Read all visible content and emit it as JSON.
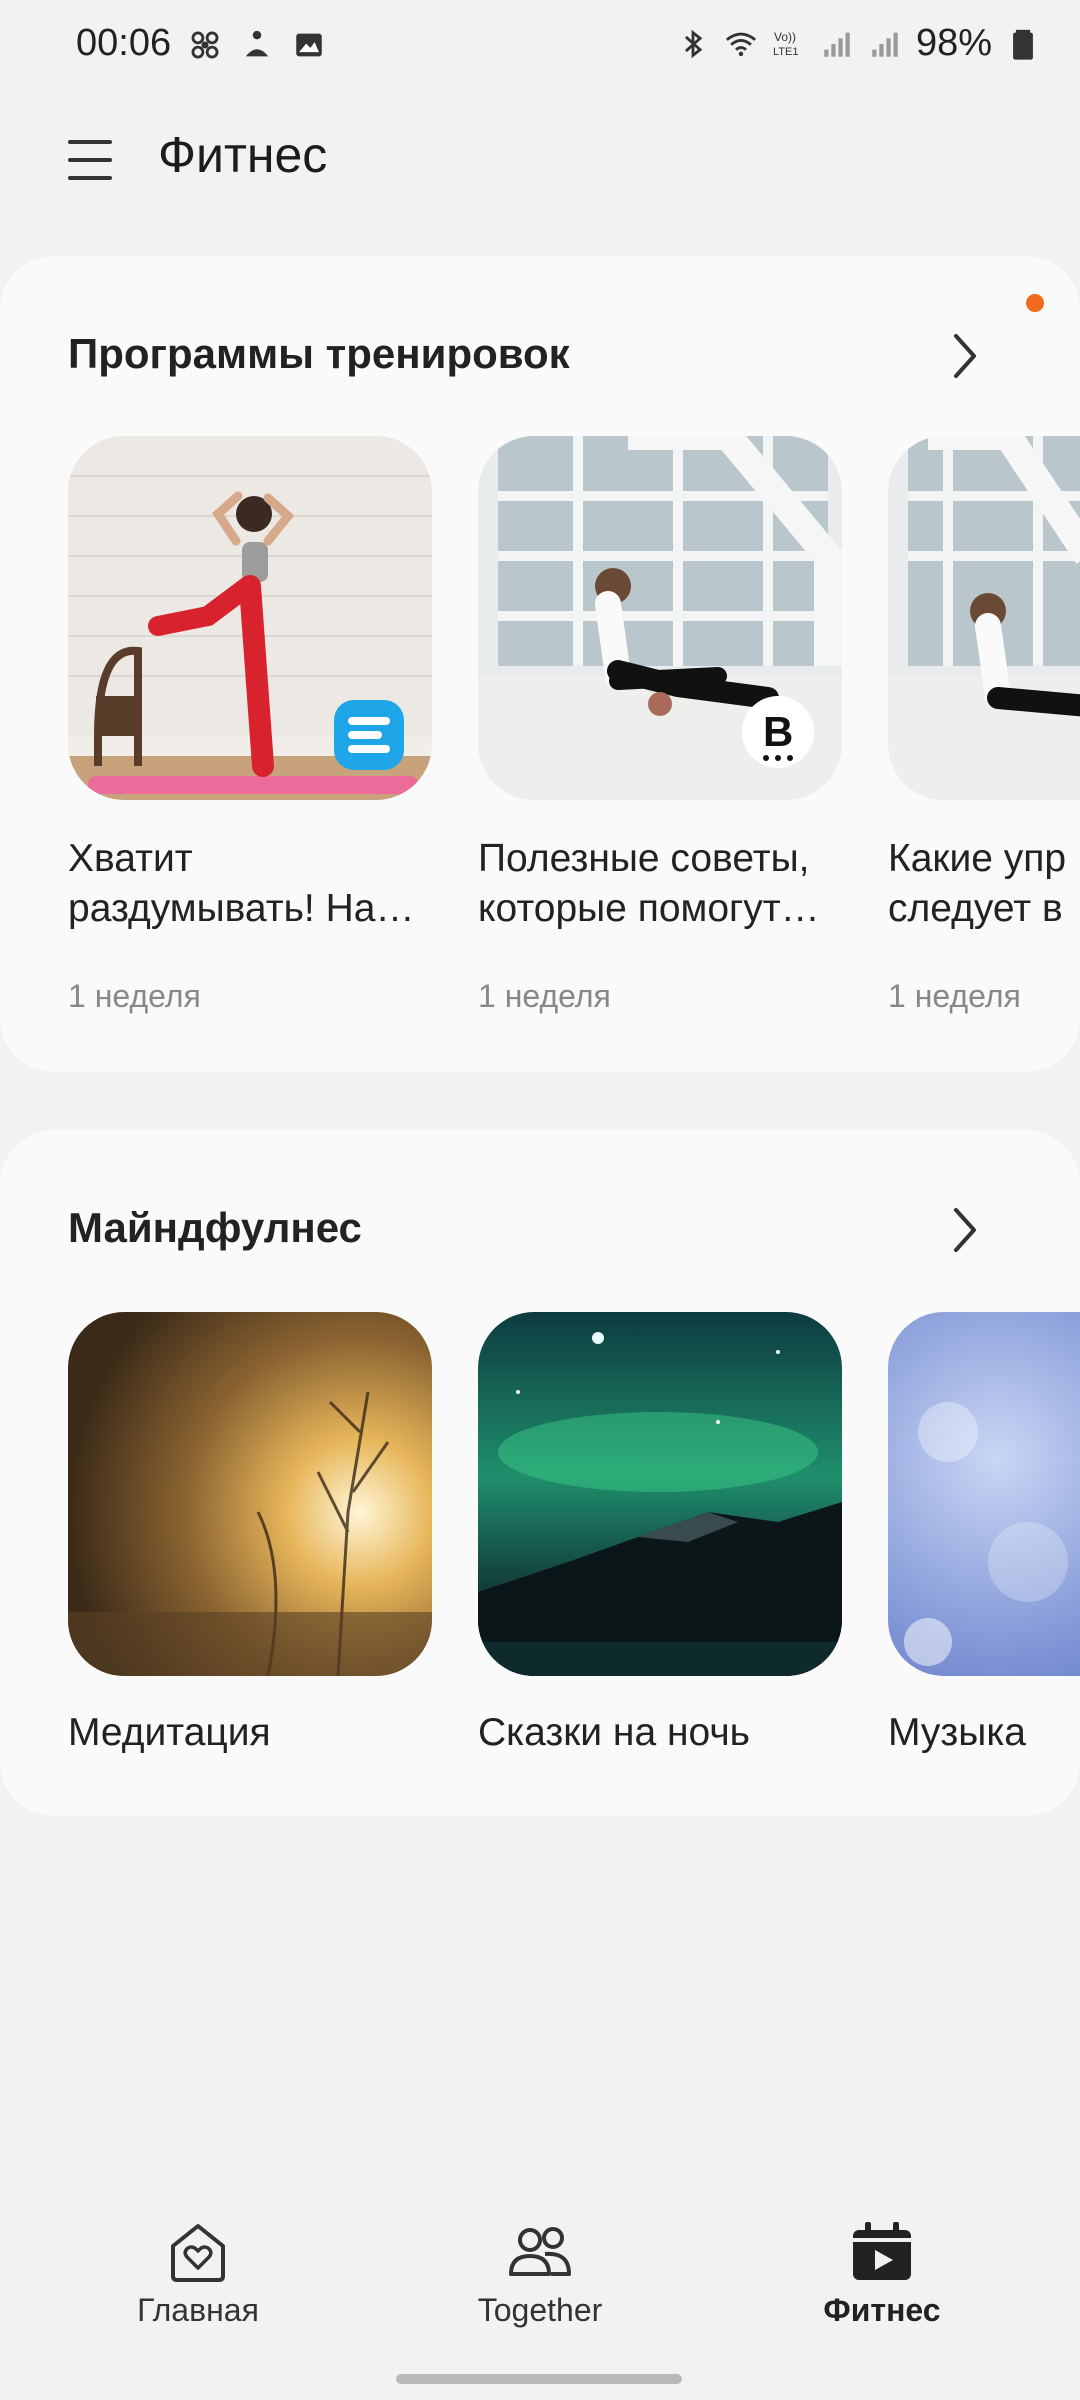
{
  "status_bar": {
    "time": "00:06",
    "battery": "98%",
    "network_label": "VoLTE1"
  },
  "header": {
    "title": "Фитнес"
  },
  "programs": {
    "title": "Программы тренировок",
    "items": [
      {
        "title": "Хватит раздумывать! На…",
        "line1": "Хватит",
        "line2": "раздумывать! На…",
        "meta": "1 неделя"
      },
      {
        "title": "Полезные советы, которые помогут…",
        "line1": "Полезные советы,",
        "line2": "которые помогут…",
        "meta": "1 неделя"
      },
      {
        "title": "Какие упр… следует в…",
        "line1": "Какие упр",
        "line2": "следует в",
        "meta": "1 неделя"
      }
    ]
  },
  "mindfulness": {
    "title": "Майндфулнес",
    "items": [
      {
        "label": "Медитация"
      },
      {
        "label": "Сказки на ночь"
      },
      {
        "label": "Музыка"
      }
    ]
  },
  "bottom_nav": {
    "items": [
      {
        "label": "Главная",
        "icon": "home-heart-icon"
      },
      {
        "label": "Together",
        "icon": "people-icon"
      },
      {
        "label": "Фитнес",
        "icon": "calendar-play-icon",
        "active": true
      }
    ]
  },
  "colors": {
    "accent_dot": "#f26b1d",
    "background": "#f2f2f2",
    "card": "#fafafa"
  }
}
